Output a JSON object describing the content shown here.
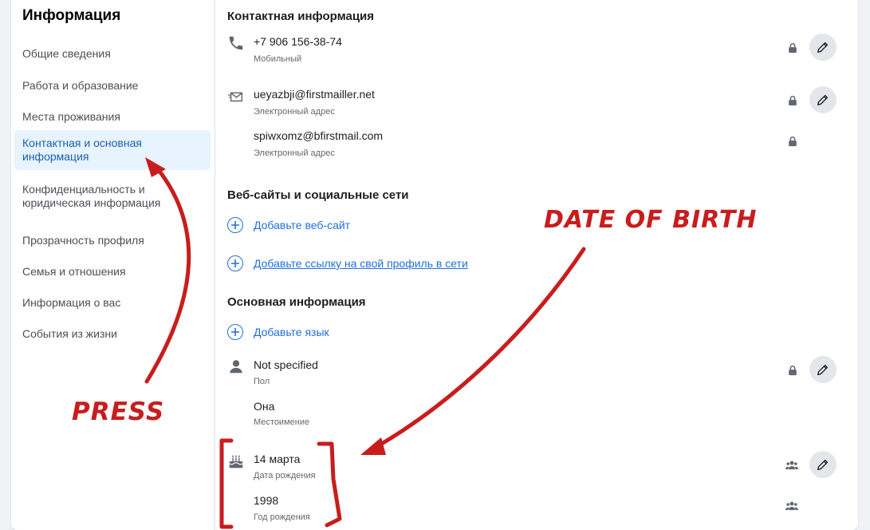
{
  "sidebar": {
    "title": "Информация",
    "items": [
      {
        "label": "Общие сведения"
      },
      {
        "label": "Работа и образование"
      },
      {
        "label": "Места проживания"
      },
      {
        "label": "Контактная и основная информация"
      },
      {
        "label": "Конфиденциальность и юридическая информация"
      },
      {
        "label": "Прозрачность профиля"
      },
      {
        "label": "Семья и отношения"
      },
      {
        "label": "Информация о вас"
      },
      {
        "label": "События из жизни"
      }
    ]
  },
  "contact": {
    "title": "Контактная информация",
    "phone": {
      "value": "+7 906 156-38-74",
      "sub": "Мобильный"
    },
    "email1": {
      "value": "ueyazbji@firstmailler.net",
      "sub": "Электронный адрес"
    },
    "email2": {
      "value": "spiwxomz@bfirstmail.com",
      "sub": "Электронный адрес"
    }
  },
  "websites": {
    "title": "Веб-сайты и социальные сети",
    "add_website": "Добавьте веб-сайт",
    "add_social": "Добавьте ссылку на свой профиль в сети"
  },
  "basic": {
    "title": "Основная информация",
    "add_language": "Добавьте язык",
    "gender": {
      "value": "Not specified",
      "sub": "Пол"
    },
    "pronoun": {
      "value": "Она",
      "sub": "Местоимение"
    },
    "birthday": {
      "value": "14 марта",
      "sub": "Дата рождения"
    },
    "birth_year": {
      "value": "1998",
      "sub": "Год рождения"
    }
  },
  "annotations": {
    "press": "PRESS",
    "date_of_birth": "DATE OF BIRTH"
  },
  "colors": {
    "accent": "#216fdb",
    "active_bg": "#e7f3ff",
    "annotation_red": "#c81d1d"
  }
}
